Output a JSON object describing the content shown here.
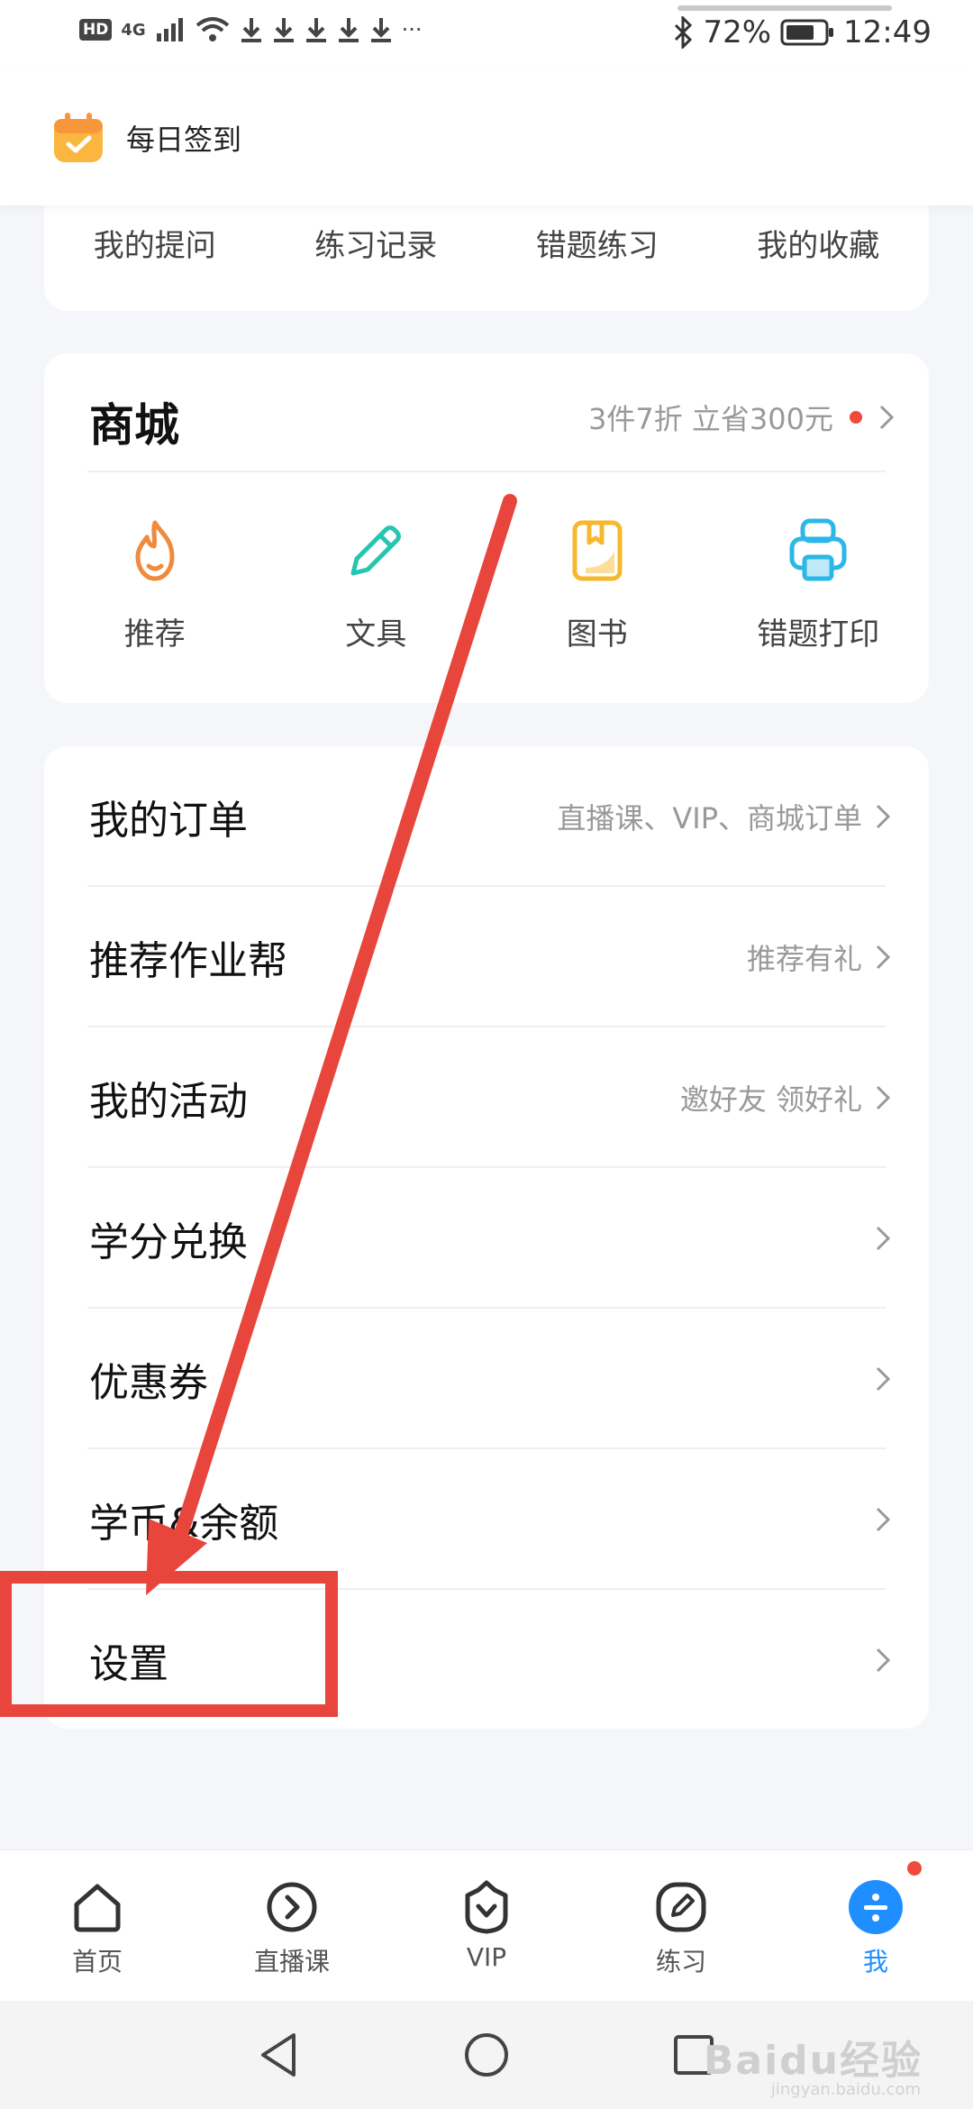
{
  "status_bar": {
    "hd": "HD",
    "network": "4G",
    "battery": "72%",
    "time": "12:49",
    "more": "···"
  },
  "header": {
    "checkin_label": "每日签到"
  },
  "quick_links": [
    "我的提问",
    "练习记录",
    "错题练习",
    "我的收藏"
  ],
  "mall": {
    "title": "商城",
    "promo": "3件7折 立省300元",
    "items": [
      {
        "label": "推荐",
        "icon": "flame-icon"
      },
      {
        "label": "文具",
        "icon": "pencil-icon"
      },
      {
        "label": "图书",
        "icon": "book-icon"
      },
      {
        "label": "错题打印",
        "icon": "printer-icon"
      }
    ]
  },
  "menu": [
    {
      "title": "我的订单",
      "subtitle": "直播课、VIP、商城订单"
    },
    {
      "title": "推荐作业帮",
      "subtitle": "推荐有礼"
    },
    {
      "title": "我的活动",
      "subtitle": "邀好友 领好礼"
    },
    {
      "title": "学分兑换",
      "subtitle": ""
    },
    {
      "title": "优惠券",
      "subtitle": ""
    },
    {
      "title": "学币&余额",
      "subtitle": ""
    },
    {
      "title": "设置",
      "subtitle": ""
    }
  ],
  "tabs": [
    {
      "label": "首页",
      "icon": "home-icon"
    },
    {
      "label": "直播课",
      "icon": "live-icon"
    },
    {
      "label": "VIP",
      "icon": "vip-icon"
    },
    {
      "label": "练习",
      "icon": "practice-icon"
    },
    {
      "label": "我",
      "icon": "profile-icon",
      "active": true
    }
  ],
  "watermark": {
    "main": "Baidu经验",
    "sub": "jingyan.baidu.com"
  },
  "colors": {
    "accent": "#1f8fff",
    "annotation": "#e8453c",
    "flame": "#f08a3c",
    "pencil": "#25c6b0",
    "book": "#f5b82e",
    "printer": "#2bb7e8"
  }
}
